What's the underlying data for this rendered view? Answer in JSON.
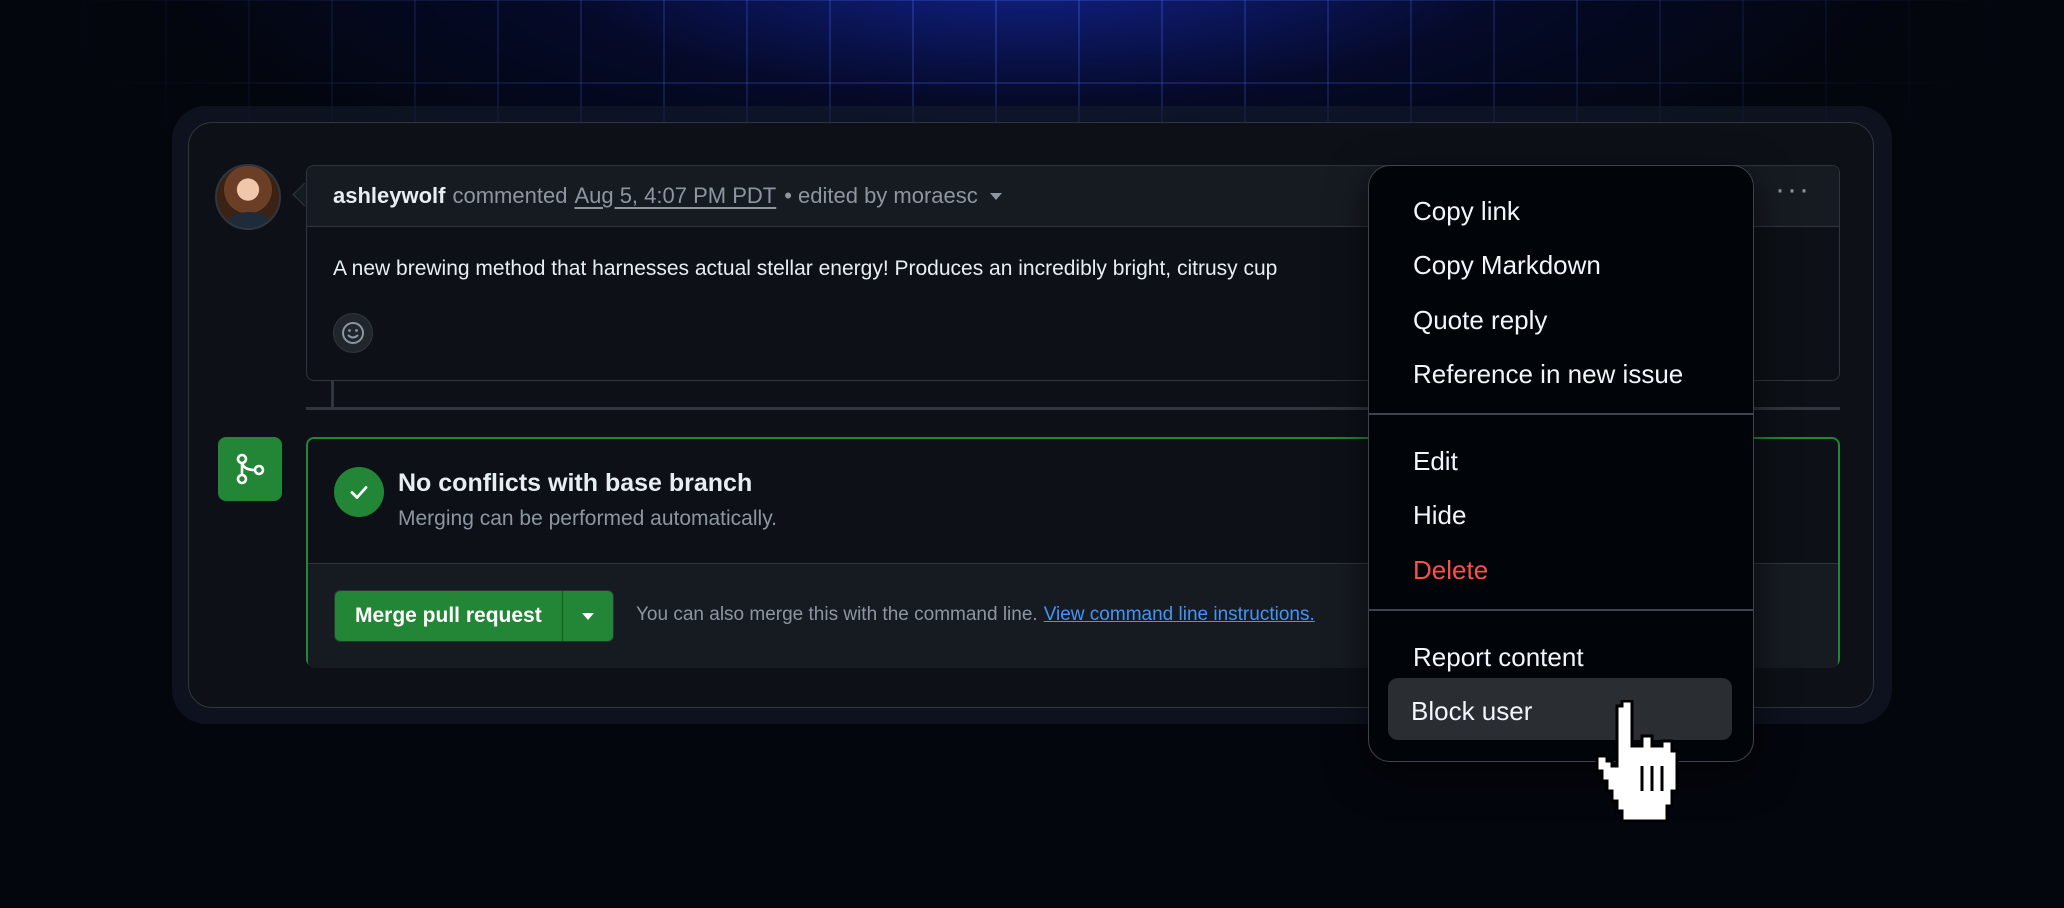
{
  "comment": {
    "author": "ashleywolf",
    "action": "commented",
    "timestamp": "Aug 5, 4:07 PM PDT",
    "edited": "• edited by moraesc",
    "body": "A new brewing method that harnesses actual stellar energy! Produces an incredibly bright, citrusy cup"
  },
  "merge": {
    "title": "No conflicts with base branch",
    "subtitle": "Merging can be performed automatically.",
    "button_label": "Merge pull request",
    "hint_text": "You can also merge this with the command line.",
    "hint_link": "View command line instructions."
  },
  "menu": {
    "copy_link": "Copy link",
    "copy_markdown": "Copy Markdown",
    "quote_reply": "Quote reply",
    "reference_issue": "Reference in new issue",
    "edit": "Edit",
    "hide": "Hide",
    "delete": "Delete",
    "report": "Report content",
    "block": "Block user"
  },
  "colors": {
    "success": "#238636",
    "danger": "#f85149",
    "link": "#4493f8"
  }
}
